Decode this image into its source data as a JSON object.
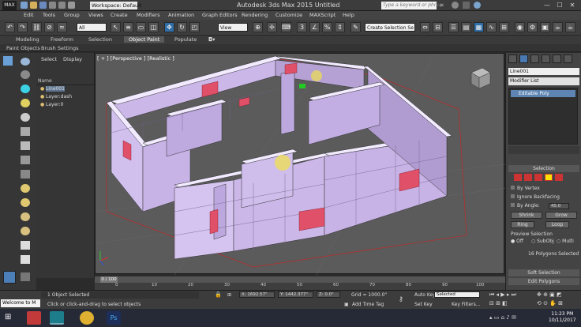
{
  "titlebar": {
    "logo": "MAX",
    "workspace": "Workspace: Default",
    "title": "Autodesk 3ds Max  2015      Untitled",
    "search_placeholder": "Type a keyword or phrase",
    "buttons": [
      "—",
      "☐",
      "✕"
    ]
  },
  "menu": [
    "Edit",
    "Tools",
    "Group",
    "Views",
    "Create",
    "Modifiers",
    "Animation",
    "Graph Editors",
    "Rendering",
    "Customize",
    "MAXScript",
    "Help"
  ],
  "toolbar": {
    "filter": "All",
    "coord": "View",
    "selection_set": "Create Selection Se"
  },
  "ribbon": {
    "tabs": [
      "Modeling",
      "Freeform",
      "Selection",
      "Object Paint",
      "Populate"
    ],
    "active_tab": "Object Paint",
    "sub": [
      "Paint Objects",
      "Brush Settings"
    ]
  },
  "explorer": {
    "tabs": [
      "Select",
      "Display"
    ],
    "column": "Name",
    "layers": [
      "Line001",
      "Layer:dash",
      "Layer:0"
    ]
  },
  "viewport": {
    "label": "[ + ] [Perspective ] [Realistic ]"
  },
  "command_panel": {
    "object_name": "Line001",
    "modifier_list": "Modifier List",
    "stack_item": "Editable Poly",
    "selection_title": "Selection",
    "by_vertex": "By Vertex",
    "ignore_backfacing": "Ignore Backfacing",
    "by_angle": "By Angle:",
    "angle_value": "45.0",
    "shrink": "Shrink",
    "grow": "Grow",
    "ring": "Ring",
    "loop": "Loop",
    "preview_title": "Preview Selection",
    "preview_opts": [
      "Off",
      "SubObj",
      "Multi"
    ],
    "selected_count": "16 Polygons Selected",
    "soft_selection": "Soft Selection",
    "edit_polygons": "Edit Polygons"
  },
  "timeline": {
    "slider": "0 / 100",
    "ticks": [
      "0",
      "10",
      "20",
      "30",
      "40",
      "50",
      "60",
      "70",
      "80",
      "90",
      "100"
    ]
  },
  "status": {
    "selected": "1 Object Selected",
    "prompt": "Click or click-and-drag to select objects",
    "x": "X: 1692.57\"",
    "y": "Y: 1442.377\"",
    "z": "Z: 0.0\"",
    "grid": "Grid = 1000.0\"",
    "add_time_tag": "Add Time Tag",
    "auto_key": "Auto Key",
    "set_key": "Set Key",
    "key_mode": "Selected",
    "key_filters": "Key Filters...",
    "welcome": "Welcome to M"
  },
  "clock": {
    "time": "11:23 PM",
    "date": "10/11/2017"
  },
  "colors": {
    "wall": "#c7b3e6",
    "wall_top": "#f0e8ff",
    "highlight": "#e05068",
    "viewport_bg": "#5b5b5b",
    "stack_sel": "#5d84b3"
  }
}
